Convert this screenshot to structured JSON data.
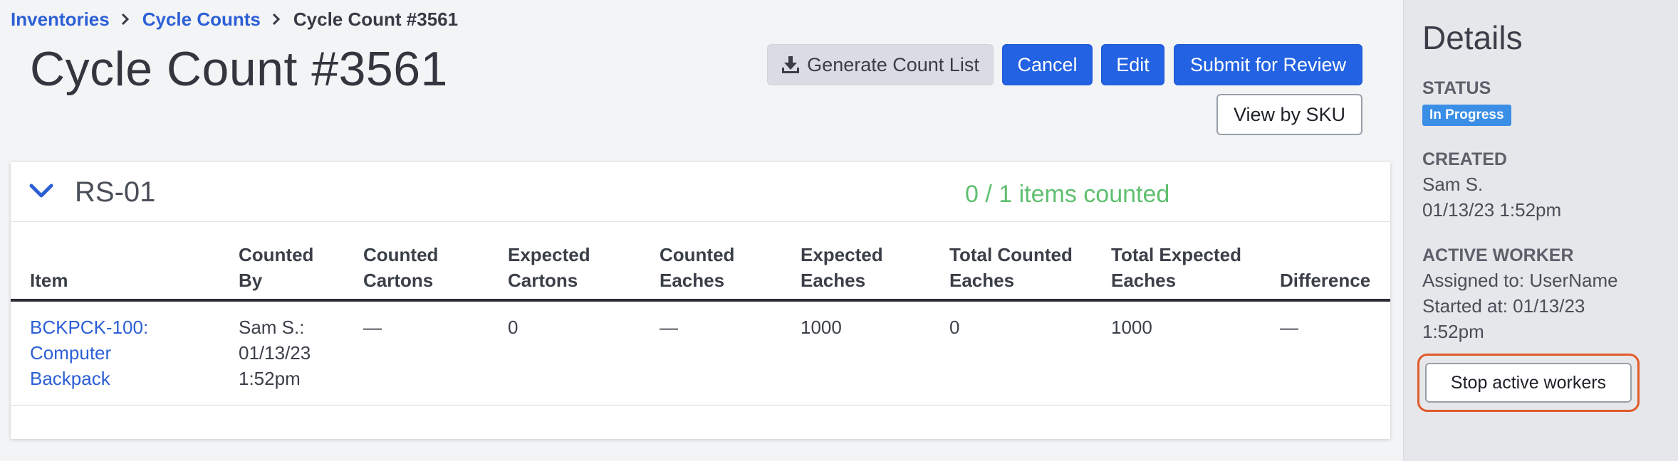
{
  "breadcrumb": {
    "items": [
      "Inventories",
      "Cycle Counts"
    ],
    "current": "Cycle Count #3561"
  },
  "page": {
    "title": "Cycle Count #3561"
  },
  "actions": {
    "generate": "Generate Count List",
    "cancel": "Cancel",
    "edit": "Edit",
    "submit": "Submit for Review",
    "view_by_sku": "View by SKU"
  },
  "section": {
    "title": "RS-01",
    "count_summary": "0 / 1 items counted"
  },
  "table": {
    "headers": [
      [
        "Item"
      ],
      [
        "Counted",
        "By"
      ],
      [
        "Counted",
        "Cartons"
      ],
      [
        "Expected",
        "Cartons"
      ],
      [
        "Counted",
        "Eaches"
      ],
      [
        "Expected",
        "Eaches"
      ],
      [
        "Total Counted",
        "Eaches"
      ],
      [
        "Total Expected",
        "Eaches"
      ],
      [
        "Difference"
      ]
    ],
    "rows": [
      {
        "item": [
          "BCKPCK-100:",
          "Computer",
          "Backpack"
        ],
        "counted_by": [
          "Sam S.:",
          "01/13/23",
          "1:52pm"
        ],
        "counted_cartons": "—",
        "expected_cartons": "0",
        "counted_eaches": "—",
        "expected_eaches": "1000",
        "total_counted_eaches": "0",
        "total_expected_eaches": "1000",
        "difference": "—"
      }
    ]
  },
  "sidebar": {
    "title": "Details",
    "status_label": "STATUS",
    "status_badge": "In Progress",
    "created_label": "CREATED",
    "created_by": "Sam S.",
    "created_at": "01/13/23 1:52pm",
    "worker_label": "ACTIVE WORKER",
    "assigned_to": "Assigned to: UserName",
    "started_at_line1": "Started at: 01/13/23",
    "started_at_line2": "1:52pm",
    "stop_button": "Stop active workers"
  },
  "colors": {
    "link": "#2c5fd6",
    "primary": "#2262e3",
    "success": "#5fbf6f",
    "badge": "#3a8ee6",
    "highlight": "#e05a2b"
  },
  "icons": [
    "download-icon",
    "chevron-right-icon",
    "chevron-down-icon"
  ]
}
